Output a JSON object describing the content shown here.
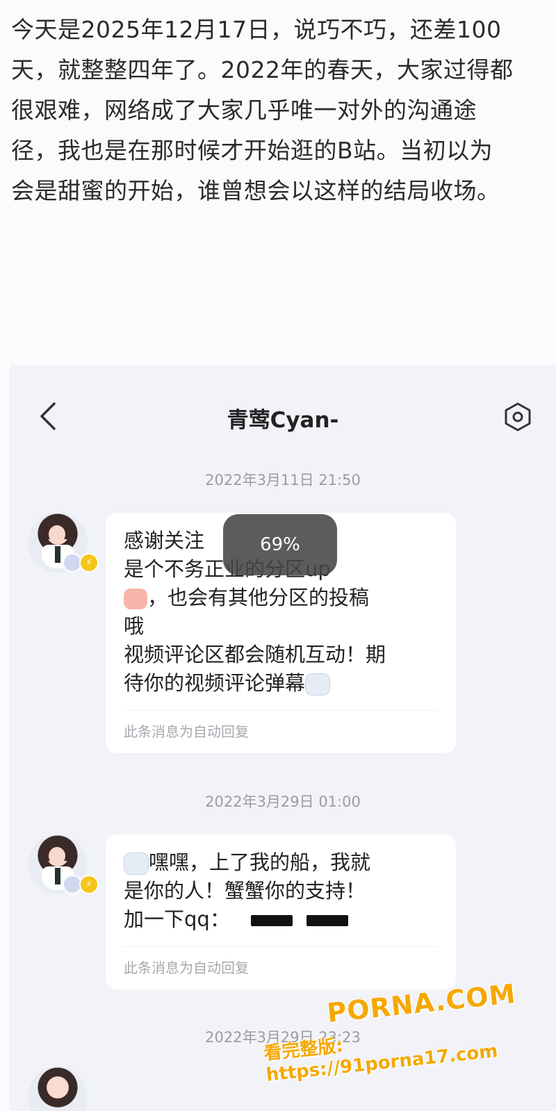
{
  "intro_text": "今天是2025年12月17日，说巧不巧，还差100\n天，就整整四年了。2022年的春天，大家过得都\n很艰难，网络成了大家几乎唯一对外的沟通途\n径，我也是在那时候才开始逛的B站。当初以为\n会是甜蜜的开始，谁曾想会以这样的结局收场。",
  "chat": {
    "title": "青莺Cyan-",
    "back_icon": "chevron-left-icon",
    "settings_icon": "gear-icon",
    "messages": [
      {
        "timestamp": "2022年3月11日 21:50",
        "lines": [
          "感谢关注",
          "是个不务正业的分区up",
          "，也会有其他分区的投稿",
          "哦",
          "视频评论区都会随机互动！期",
          "待你的视频评论弹幕"
        ],
        "auto_reply": "此条消息为自动回复"
      },
      {
        "timestamp": "2022年3月29日 01:00",
        "lines": [
          "嘿嘿，上了我的船，我就",
          "是你的人！蟹蟹你的支持！",
          "加一下qq："
        ],
        "auto_reply": "此条消息为自动回复"
      },
      {
        "timestamp": "2022年3月29日 23:23"
      }
    ],
    "toast": "69%"
  },
  "watermark": {
    "brand": "PORNA.COM",
    "url_line": "看完整版: https://91porna17.com"
  },
  "colors": {
    "background": "#fbfbfd",
    "chat_bg": "#f1f3f8",
    "bubble": "#ffffff",
    "timestamp": "#9a9ca3",
    "watermark": "#f6a800"
  }
}
